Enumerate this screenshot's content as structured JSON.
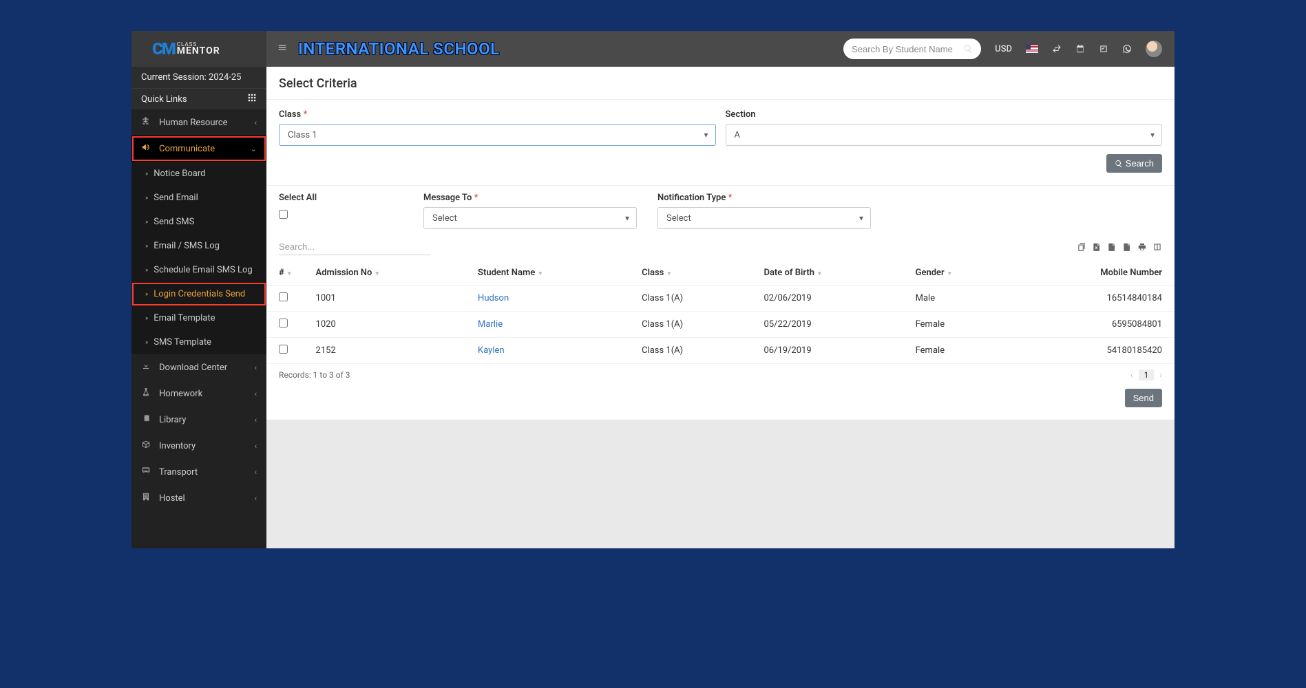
{
  "session": "Current Session: 2024-25",
  "quick_links_label": "Quick Links",
  "header": {
    "school": "INTERNATIONAL SCHOOL",
    "search_placeholder": "Search By Student Name",
    "currency": "USD"
  },
  "sidebar": {
    "items": [
      {
        "icon": "sitemap",
        "label": "Human Resource",
        "expandable": true
      },
      {
        "icon": "bullhorn",
        "label": "Communicate",
        "expandable": true,
        "active": true,
        "highlighted": true,
        "children": [
          {
            "label": "Notice Board"
          },
          {
            "label": "Send Email"
          },
          {
            "label": "Send SMS"
          },
          {
            "label": "Email / SMS Log"
          },
          {
            "label": "Schedule Email SMS Log"
          },
          {
            "label": "Login Credentials Send",
            "selected": true,
            "highlighted": true
          },
          {
            "label": "Email Template"
          },
          {
            "label": "SMS Template"
          }
        ]
      },
      {
        "icon": "download",
        "label": "Download Center",
        "expandable": true
      },
      {
        "icon": "flask",
        "label": "Homework",
        "expandable": true
      },
      {
        "icon": "book",
        "label": "Library",
        "expandable": true
      },
      {
        "icon": "box",
        "label": "Inventory",
        "expandable": true
      },
      {
        "icon": "bus",
        "label": "Transport",
        "expandable": true
      },
      {
        "icon": "building",
        "label": "Hostel",
        "expandable": true
      }
    ]
  },
  "content": {
    "title": "Select Criteria",
    "class_label": "Class",
    "class_value": "Class 1",
    "section_label": "Section",
    "section_value": "A",
    "search_btn": "Search",
    "select_all_label": "Select All",
    "message_to_label": "Message To",
    "message_to_value": "Select",
    "notification_type_label": "Notification Type",
    "notification_type_value": "Select",
    "table_search_placeholder": "Search...",
    "columns": {
      "hash": "#",
      "admission": "Admission No",
      "name": "Student Name",
      "class": "Class",
      "dob": "Date of Birth",
      "gender": "Gender",
      "mobile": "Mobile Number"
    },
    "rows": [
      {
        "admission": "1001",
        "name": "Hudson",
        "class": "Class 1(A)",
        "dob": "02/06/2019",
        "gender": "Male",
        "mobile": "16514840184"
      },
      {
        "admission": "1020",
        "name": "Marlie",
        "class": "Class 1(A)",
        "dob": "05/22/2019",
        "gender": "Female",
        "mobile": "6595084801"
      },
      {
        "admission": "2152",
        "name": "Kaylen",
        "class": "Class 1(A)",
        "dob": "06/19/2019",
        "gender": "Female",
        "mobile": "54180185420"
      }
    ],
    "records_text": "Records: 1 to 3 of 3",
    "page": "1",
    "send_btn": "Send"
  }
}
